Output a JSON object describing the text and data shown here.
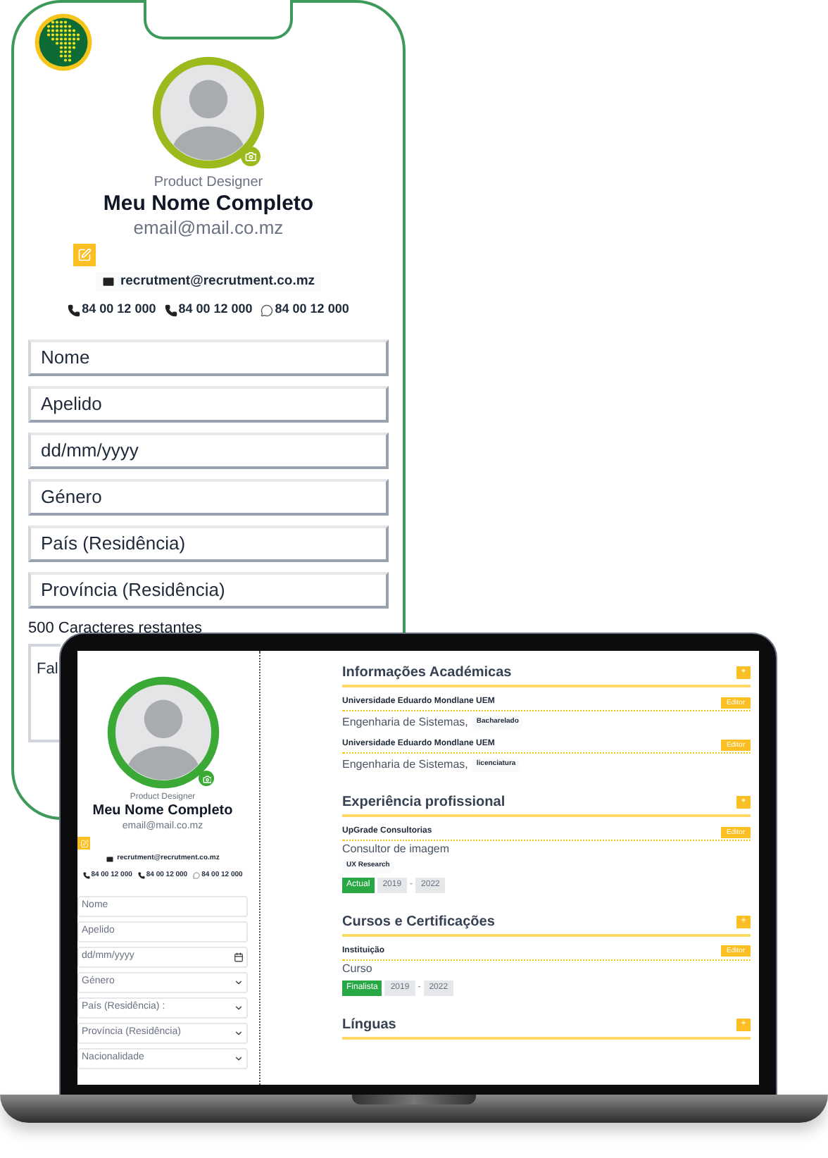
{
  "phone": {
    "profile": {
      "role": "Product Designer",
      "name": "Meu Nome Completo",
      "email": "email@mail.co.mz",
      "contact_email": "recrutment@recrutment.co.mz",
      "phones": [
        {
          "kind": "phone",
          "number": "84 00 12 000"
        },
        {
          "kind": "phone",
          "number": "84 00 12 000"
        },
        {
          "kind": "whatsapp",
          "number": "84 00 12 000"
        }
      ]
    },
    "fields": [
      {
        "placeholder": "Nome"
      },
      {
        "placeholder": "Apelido"
      },
      {
        "placeholder": "dd/mm/yyyy"
      },
      {
        "placeholder": "Género"
      },
      {
        "placeholder": "País (Residência)"
      },
      {
        "placeholder": "Província (Residência)"
      }
    ],
    "char_count": "500 Caracteres restantes",
    "textarea": {
      "placeholder": "Fal"
    }
  },
  "laptop": {
    "sidebar": {
      "profile": {
        "role": "Product Designer",
        "name": "Meu Nome Completo",
        "email": "email@mail.co.mz",
        "contact_email": "recrutment@recrutment.co.mz",
        "phones": [
          {
            "kind": "phone",
            "number": "84 00 12 000"
          },
          {
            "kind": "phone",
            "number": "84 00 12 000"
          },
          {
            "kind": "whatsapp",
            "number": "84 00 12 000"
          }
        ]
      },
      "fields": [
        {
          "kind": "text",
          "placeholder": "Nome"
        },
        {
          "kind": "text",
          "placeholder": "Apelido"
        },
        {
          "kind": "date",
          "placeholder": "dd/mm/yyyy"
        },
        {
          "kind": "select",
          "placeholder": "Género"
        },
        {
          "kind": "select",
          "placeholder": "País (Residência) :"
        },
        {
          "kind": "select",
          "placeholder": "Província (Residência)"
        },
        {
          "kind": "select",
          "placeholder": "Nacionalidade"
        }
      ]
    },
    "sections": [
      {
        "title": "Informações Académicas",
        "add": "+",
        "entries": [
          {
            "kind": "degree",
            "title": "Universidade Eduardo Mondlane UEM",
            "edit": "Editor",
            "detail": "Engenharia de Sistemas,",
            "tag": "Bacharelado"
          },
          {
            "kind": "degree",
            "title": "Universidade Eduardo Mondlane UEM",
            "edit": "Editor",
            "detail": "Engenharia de Sistemas,",
            "tag": "licenciatura"
          }
        ]
      },
      {
        "title": "Experiência profissional",
        "add": "+",
        "entries": [
          {
            "kind": "job",
            "title": "UpGrade Consultorias",
            "edit": "Editor",
            "detail": "Consultor de imagem",
            "tag": "UX Research",
            "status": "Actual",
            "start": "2019",
            "separator": "-",
            "end": "2022"
          }
        ]
      },
      {
        "title": "Cursos e Certificações",
        "add": "+",
        "entries": [
          {
            "kind": "course",
            "title": "Instituição",
            "edit": "Editor",
            "detail": "Curso",
            "status": "Finalista",
            "start": "2019",
            "separator": "-",
            "end": "2022"
          }
        ]
      },
      {
        "title": "Línguas",
        "add": "+"
      }
    ]
  }
}
